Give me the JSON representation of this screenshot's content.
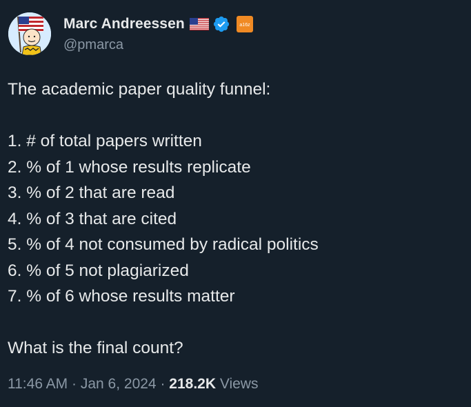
{
  "author": {
    "display_name": "Marc Andreessen",
    "handle": "@pmarca",
    "flag_icon": "us-flag-icon",
    "verified_icon": "verified-badge-icon",
    "affiliate_label": "a16z",
    "colors": {
      "verified": "#1d9bf0",
      "affiliate": "#f08a24"
    }
  },
  "tweet": {
    "intro": "The academic paper quality funnel:",
    "items": [
      "1. # of total papers written",
      "2. % of 1 whose results replicate",
      "3. % of 2 that are read",
      "4. % of 3 that are cited",
      "5. % of 4 not consumed by radical politics",
      "6. % of 5 not plagiarized",
      "7. % of 6 whose results matter"
    ],
    "closing": "What is the final count?"
  },
  "meta": {
    "time": "11:46 AM",
    "separator": " · ",
    "date": "Jan 6, 2024",
    "views_count": "218.2K",
    "views_label": " Views"
  },
  "colors": {
    "background": "#15202b",
    "text": "#e7e9ea",
    "secondary": "#8b98a5"
  }
}
